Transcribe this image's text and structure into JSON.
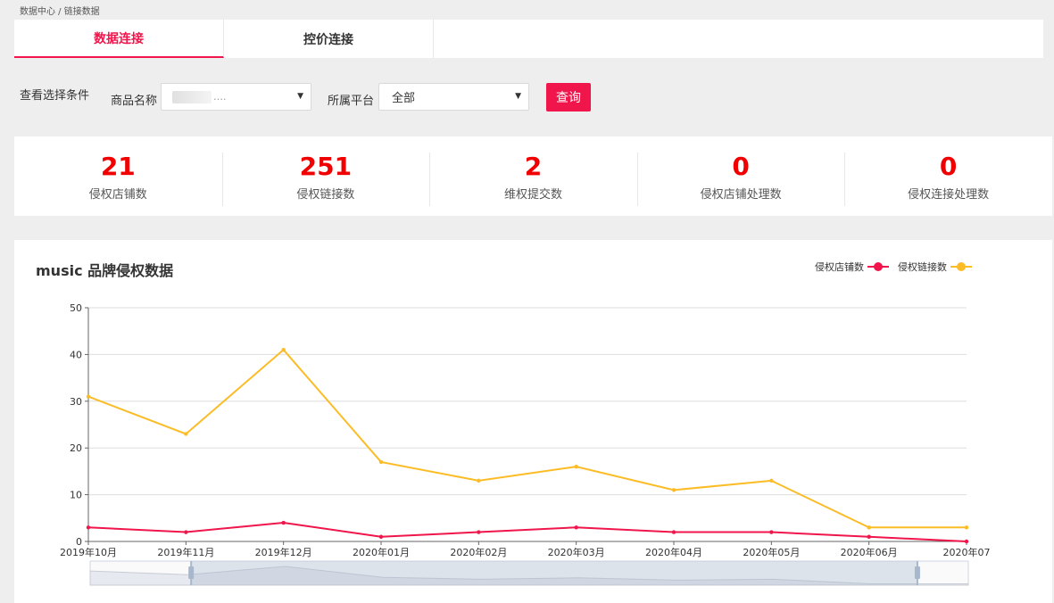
{
  "breadcrumb": "数据中心 / 链接数据",
  "tabs": [
    {
      "label": "数据连接",
      "active": true
    },
    {
      "label": "控价连接",
      "active": false
    }
  ],
  "filters": {
    "section_label": "查看选择条件",
    "product_label": "商品名称",
    "product_value": "….",
    "platform_label": "所属平台",
    "platform_value": "全部",
    "query_label": "查询"
  },
  "stats": [
    {
      "value": "21",
      "label": "侵权店铺数"
    },
    {
      "value": "251",
      "label": "侵权链接数"
    },
    {
      "value": "2",
      "label": "维权提交数"
    },
    {
      "value": "0",
      "label": "侵权店铺处理数"
    },
    {
      "value": "0",
      "label": "侵权连接处理数"
    }
  ],
  "colors": {
    "accent": "#f0154b",
    "stat_value": "#f00000",
    "series_shops": "#f0154b",
    "series_links": "#fbbc26"
  },
  "chart_data": {
    "type": "line",
    "title": "music 品牌侵权数据",
    "categories": [
      "2019年10月",
      "2019年11月",
      "2019年12月",
      "2020年01月",
      "2020年02月",
      "2020年03月",
      "2020年04月",
      "2020年05月",
      "2020年06月",
      "2020年07"
    ],
    "series": [
      {
        "name": "侵权店铺数",
        "values": [
          3,
          2,
          4,
          1,
          2,
          3,
          2,
          2,
          1,
          0
        ]
      },
      {
        "name": "侵权链接数",
        "values": [
          31,
          23,
          41,
          17,
          13,
          16,
          11,
          13,
          3,
          3
        ]
      }
    ],
    "ylim": [
      0,
      50
    ],
    "yticks": [
      0,
      10,
      20,
      30,
      40,
      50
    ],
    "grid": true,
    "legend": "top-right",
    "zoom_range": [
      0.115,
      0.942
    ]
  }
}
